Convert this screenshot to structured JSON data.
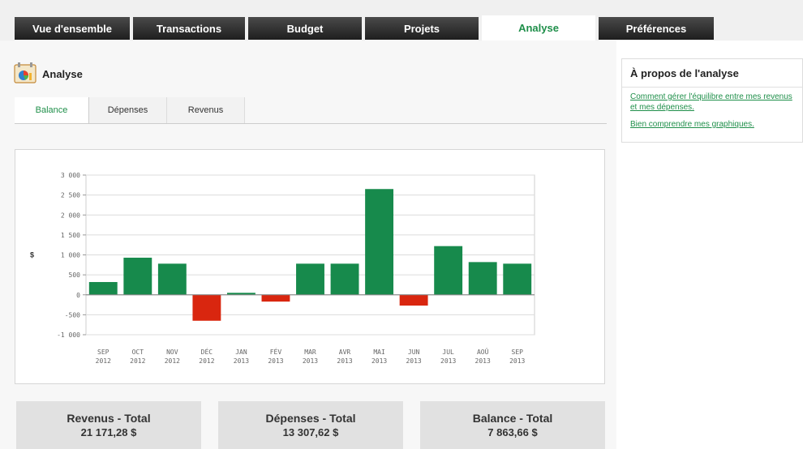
{
  "nav": {
    "tabs": [
      {
        "label": "Vue d'ensemble"
      },
      {
        "label": "Transactions"
      },
      {
        "label": "Budget"
      },
      {
        "label": "Projets"
      },
      {
        "label": "Analyse"
      },
      {
        "label": "Préférences"
      }
    ],
    "active": "Analyse"
  },
  "page": {
    "title": "Analyse",
    "icon": "analysis-chart-icon"
  },
  "subtabs": [
    {
      "label": "Balance"
    },
    {
      "label": "Dépenses"
    },
    {
      "label": "Revenus"
    }
  ],
  "chart_data": {
    "type": "bar",
    "ylabel": "$",
    "ylim": [
      -1000,
      3000
    ],
    "yticks": [
      "3 000",
      "2 500",
      "2 000",
      "1 500",
      "1 000",
      "500",
      "0",
      "-500",
      "-1 000"
    ],
    "ytick_values": [
      3000,
      2500,
      2000,
      1500,
      1000,
      500,
      0,
      -500,
      -1000
    ],
    "categories": [
      "SEP 2012",
      "OCT 2012",
      "NOV 2012",
      "DÉC 2012",
      "JAN 2013",
      "FÉV 2013",
      "MAR 2013",
      "AVR 2013",
      "MAI 2013",
      "JUN 2013",
      "JUL 2013",
      "AOÛ 2013",
      "SEP 2013"
    ],
    "category_lines": [
      [
        "SEP",
        "2012"
      ],
      [
        "OCT",
        "2012"
      ],
      [
        "NOV",
        "2012"
      ],
      [
        "DÉC",
        "2012"
      ],
      [
        "JAN",
        "2013"
      ],
      [
        "FÉV",
        "2013"
      ],
      [
        "MAR",
        "2013"
      ],
      [
        "AVR",
        "2013"
      ],
      [
        "MAI",
        "2013"
      ],
      [
        "JUN",
        "2013"
      ],
      [
        "JUL",
        "2013"
      ],
      [
        "AOÛ",
        "2013"
      ],
      [
        "SEP",
        "2013"
      ]
    ],
    "values": [
      320,
      930,
      780,
      -650,
      50,
      -170,
      780,
      780,
      2650,
      -270,
      1220,
      820,
      780
    ],
    "positive_color": "#178a4c",
    "negative_color": "#d9260f",
    "grid": true
  },
  "totals": [
    {
      "title": "Revenus - Total",
      "value": "21 171,28 $"
    },
    {
      "title": "Dépenses - Total",
      "value": "13 307,62 $"
    },
    {
      "title": "Balance - Total",
      "value": "7 863,66 $"
    }
  ],
  "about": {
    "title": "À propos de l'analyse",
    "links": [
      {
        "text": "Comment gérer l'équilibre entre mes revenus et mes dépenses."
      },
      {
        "text": "Bien comprendre mes graphiques."
      }
    ]
  },
  "colors": {
    "accent": "#1f8f4a",
    "tab_dark": "#2a2a2a"
  }
}
